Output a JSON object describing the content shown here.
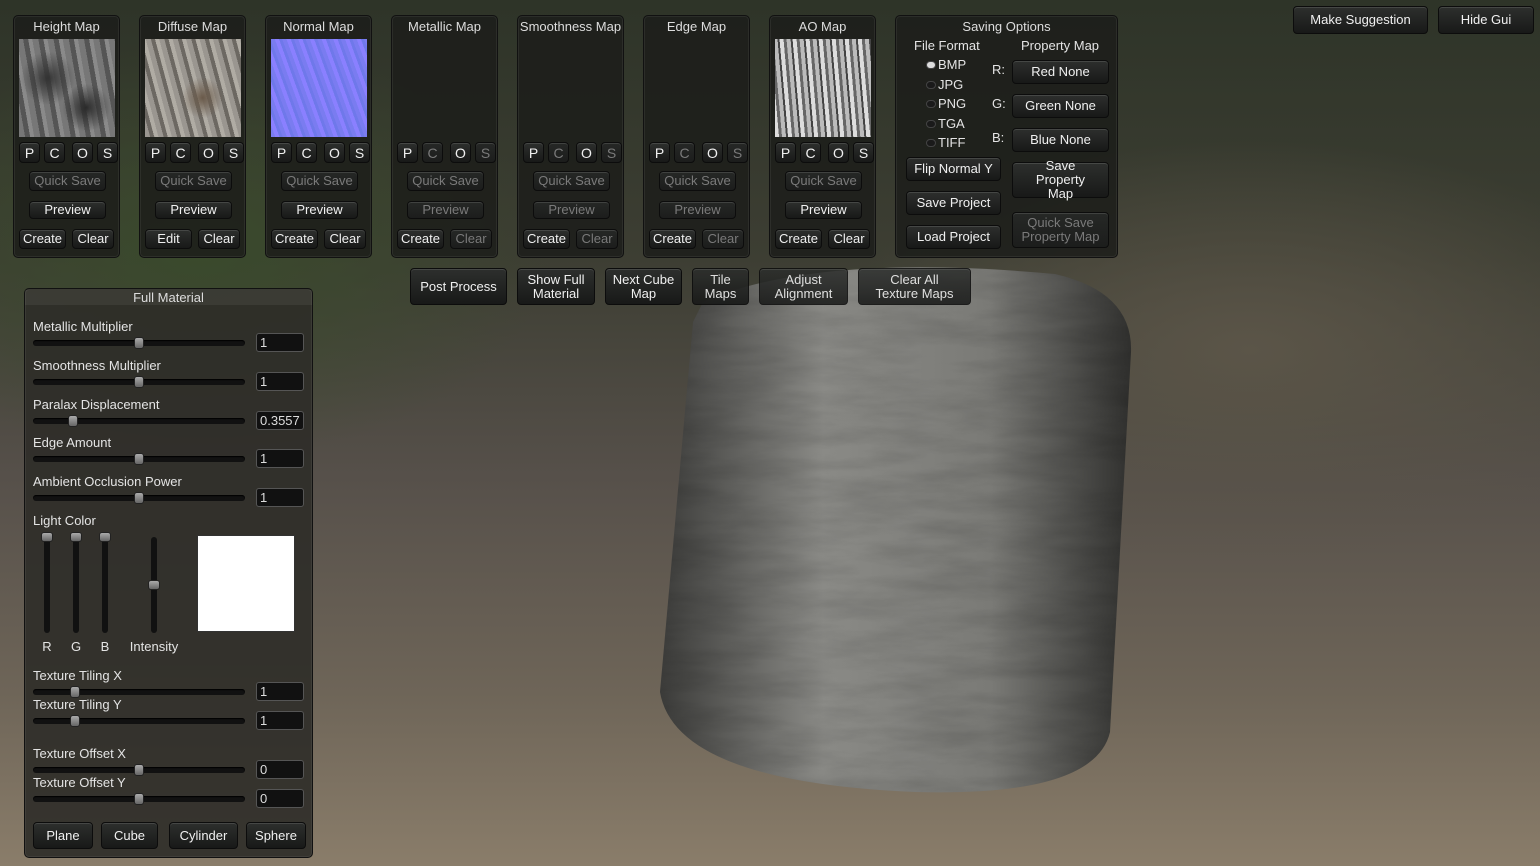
{
  "map_panels": [
    {
      "title": "Height Map",
      "thumb": "height",
      "buttons": [
        "P",
        "C",
        "O",
        "S"
      ],
      "disabled_pcos": [],
      "quick_save": "Quick Save",
      "quick_save_enabled": false,
      "preview": "Preview",
      "preview_enabled": true,
      "left": "Create",
      "right": "Clear",
      "right_enabled": true
    },
    {
      "title": "Diffuse Map",
      "thumb": "diffuse",
      "buttons": [
        "P",
        "C",
        "O",
        "S"
      ],
      "disabled_pcos": [],
      "quick_save": "Quick Save",
      "quick_save_enabled": false,
      "preview": "Preview",
      "preview_enabled": true,
      "left": "Edit",
      "right": "Clear",
      "right_enabled": true
    },
    {
      "title": "Normal Map",
      "thumb": "normal",
      "buttons": [
        "P",
        "C",
        "O",
        "S"
      ],
      "disabled_pcos": [],
      "quick_save": "Quick Save",
      "quick_save_enabled": false,
      "preview": "Preview",
      "preview_enabled": true,
      "left": "Create",
      "right": "Clear",
      "right_enabled": true
    },
    {
      "title": "Metallic Map",
      "thumb": "empty",
      "buttons": [
        "P",
        "C",
        "O",
        "S"
      ],
      "disabled_pcos": [
        "C",
        "S"
      ],
      "quick_save": "Quick Save",
      "quick_save_enabled": false,
      "preview": "Preview",
      "preview_enabled": false,
      "left": "Create",
      "right": "Clear",
      "right_enabled": false
    },
    {
      "title": "Smoothness Map",
      "thumb": "empty",
      "buttons": [
        "P",
        "C",
        "O",
        "S"
      ],
      "disabled_pcos": [
        "C",
        "S"
      ],
      "quick_save": "Quick Save",
      "quick_save_enabled": false,
      "preview": "Preview",
      "preview_enabled": false,
      "left": "Create",
      "right": "Clear",
      "right_enabled": false
    },
    {
      "title": "Edge Map",
      "thumb": "empty",
      "buttons": [
        "P",
        "C",
        "O",
        "S"
      ],
      "disabled_pcos": [
        "C",
        "S"
      ],
      "quick_save": "Quick Save",
      "quick_save_enabled": false,
      "preview": "Preview",
      "preview_enabled": false,
      "left": "Create",
      "right": "Clear",
      "right_enabled": false
    },
    {
      "title": "AO Map",
      "thumb": "ao",
      "buttons": [
        "P",
        "C",
        "O",
        "S"
      ],
      "disabled_pcos": [],
      "quick_save": "Quick Save",
      "quick_save_enabled": false,
      "preview": "Preview",
      "preview_enabled": true,
      "left": "Create",
      "right": "Clear",
      "right_enabled": true
    }
  ],
  "saving": {
    "title": "Saving Options",
    "file_format_label": "File Format",
    "property_map_label": "Property Map",
    "formats": [
      "BMP",
      "JPG",
      "PNG",
      "TGA",
      "TIFF"
    ],
    "selected_format": "BMP",
    "channels": [
      {
        "label": "R:",
        "value": "Red None"
      },
      {
        "label": "G:",
        "value": "Green None"
      },
      {
        "label": "B:",
        "value": "Blue None"
      }
    ],
    "flip_normal": "Flip Normal Y",
    "save_project": "Save Project",
    "load_project": "Load Project",
    "save_property_map": "Save Property Map",
    "quick_save_property_map": "Quick Save Property Map"
  },
  "top_right": {
    "make_suggestion": "Make Suggestion",
    "hide_gui": "Hide Gui"
  },
  "toolbar": {
    "post_process": "Post Process",
    "show_full_material": "Show Full Material",
    "next_cube_map": "Next Cube Map",
    "tile_maps": "Tile Maps",
    "adjust_alignment": "Adjust Alignment",
    "clear_all": "Clear All Texture Maps"
  },
  "full_material": {
    "title": "Full Material",
    "sliders": [
      {
        "label": "Metallic Multiplier",
        "value": "1",
        "level": 0.5
      },
      {
        "label": "Smoothness Multiplier",
        "value": "1",
        "level": 0.5
      },
      {
        "label": "Paralax Displacement",
        "value": "0.3557",
        "level": 0.19
      },
      {
        "label": "Edge Amount",
        "value": "1",
        "level": 0.5
      },
      {
        "label": "Ambient Occlusion Power",
        "value": "1",
        "level": 0.5
      }
    ],
    "light_color": {
      "label": "Light Color",
      "r": 1,
      "g": 1,
      "b": 1,
      "intensity": 0.5,
      "labels": [
        "R",
        "G",
        "B",
        "Intensity"
      ],
      "swatch": "#ffffff"
    },
    "tiling": [
      {
        "label": "Texture Tiling X",
        "value": "1",
        "level": 0.2
      },
      {
        "label": "Texture Tiling Y",
        "value": "1",
        "level": 0.2
      },
      {
        "label": "Texture Offset X",
        "value": "0",
        "level": 0.5
      },
      {
        "label": "Texture Offset Y",
        "value": "0",
        "level": 0.5
      }
    ],
    "shapes": [
      "Plane",
      "Cube",
      "Cylinder",
      "Sphere"
    ],
    "selected_shape": "Cylinder"
  }
}
